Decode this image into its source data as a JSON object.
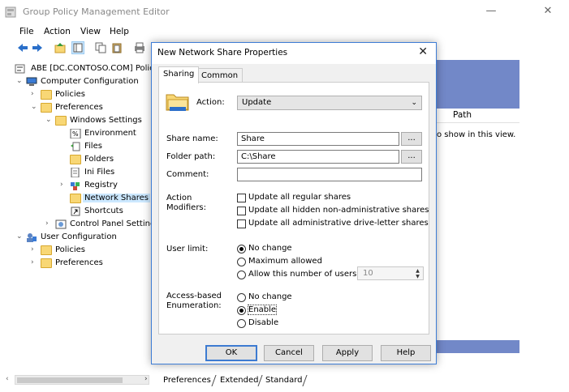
{
  "window": {
    "title": "Group Policy Management Editor",
    "minimize": "—",
    "close": "✕"
  },
  "menu": [
    "File",
    "Action",
    "View",
    "Help"
  ],
  "toolbar": [
    "back-icon",
    "forward-icon",
    "up-icon",
    "show-hide-tree-icon",
    "copy-icon",
    "paste-icon",
    "print-icon"
  ],
  "tree": {
    "root": "ABE [DC.CONTOSO.COM] Polic",
    "computer_config": "Computer Configuration",
    "cc_policies": "Policies",
    "cc_preferences": "Preferences",
    "windows_settings": "Windows Settings",
    "environment": "Environment",
    "files": "Files",
    "folders": "Folders",
    "ini_files": "Ini Files",
    "registry": "Registry",
    "network_shares": "Network Shares",
    "shortcuts": "Shortcuts",
    "control_panel": "Control Panel Setting",
    "user_config": "User Configuration",
    "uc_policies": "Policies",
    "uc_preferences": "Preferences"
  },
  "right_pane": {
    "column_path": "Path",
    "empty_message": "o show in this view."
  },
  "bottom_tabs": [
    "Preferences",
    "Extended",
    "Standard"
  ],
  "dialog": {
    "title": "New Network Share Properties",
    "close": "✕",
    "tabs": [
      "Sharing",
      "Common"
    ],
    "action_label": "Action:",
    "action_value": "Update",
    "share_name_label": "Share name:",
    "share_name_value": "Share",
    "folder_path_label": "Folder path:",
    "folder_path_value": "C:\\Share",
    "comment_label": "Comment:",
    "comment_value": "",
    "browse": "...",
    "action_modifiers_label_1": "Action",
    "action_modifiers_label_2": "Modifiers:",
    "modifiers": [
      "Update all regular shares",
      "Update all hidden non-administrative shares",
      "Update all administrative drive-letter shares"
    ],
    "user_limit_label": "User limit:",
    "user_limit_options": [
      "No change",
      "Maximum allowed",
      "Allow this number of users:"
    ],
    "user_limit_selected": 0,
    "users_number": "10",
    "abe_label_1": "Access-based",
    "abe_label_2": "Enumeration:",
    "abe_options": [
      "No change",
      "Enable",
      "Disable"
    ],
    "abe_selected": 1,
    "buttons": {
      "ok": "OK",
      "cancel": "Cancel",
      "apply": "Apply",
      "help": "Help"
    }
  }
}
